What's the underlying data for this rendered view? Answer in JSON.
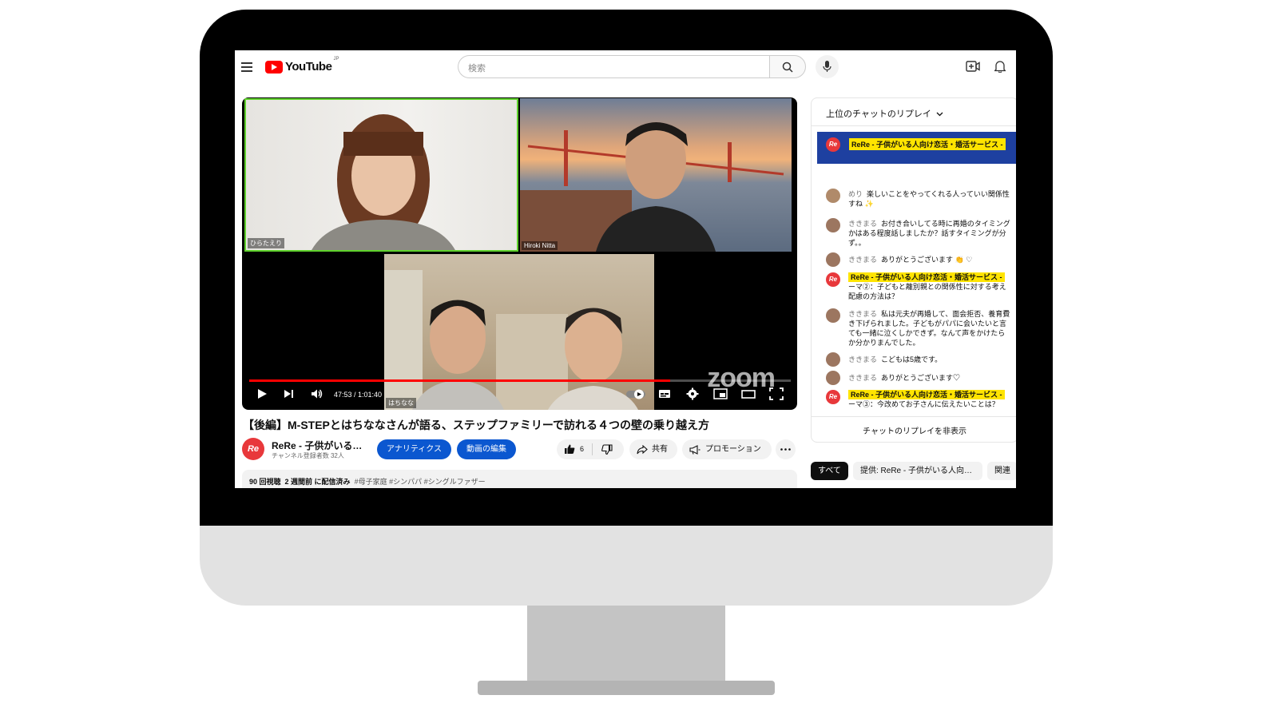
{
  "header": {
    "logo_text": "YouTube",
    "logo_region": "JP",
    "search_placeholder": "検索"
  },
  "player": {
    "participants": [
      "ひらたえり",
      "Hiroki Nitta",
      "はちなな"
    ],
    "watermark": "zoom",
    "time": "47:53 / 1:01:40",
    "progress": 0.777
  },
  "video": {
    "title": "【後編】M-STEPとはちななさんが語る、ステップファミリーで訪れる４つの壁の乗り越え方",
    "channel_name": "ReRe - 子供がいる…",
    "channel_subs": "チャンネル登録者数 32人",
    "avatar_text": "Re",
    "analytics_label": "アナリティクス",
    "edit_label": "動画の編集",
    "like_count": "6",
    "share_label": "共有",
    "promote_label": "プロモーション",
    "views": "90 回視聴",
    "date": "2 週間前 に配信済み",
    "tags": "#母子家庭 #シンパパ #シングルファザー"
  },
  "chat": {
    "header": "上位のチャットのリプレイ",
    "pinned_author": "ReRe - 子供がいる人向け恋活・婚活サービス -",
    "messages": [
      {
        "author": "めり",
        "lines": [
          "楽しいことをやってくれる人っていい関係性",
          "すね ✨"
        ]
      },
      {
        "author": "ききまる",
        "lines": [
          "お付き合いしてる時に再婚のタイミング",
          "かはある程度話しましたか？話すタイミングが分",
          "ず。。"
        ]
      },
      {
        "author": "ききまる",
        "lines": [
          "ありがとうございます 👏 ♡"
        ]
      },
      {
        "author": "ReRe - 子供がいる人向け恋活・婚活サービス -",
        "lines": [
          "ーマ②：子どもと離別親との関係性に対する考え",
          "配慮の方法は？"
        ]
      },
      {
        "author": "ききまる",
        "lines": [
          "私は元夫が再婚して、面会拒否、養育費",
          "き下げられました。子どもがパパに会いたいと言",
          "ても一緒に泣くしかできず。なんて声をかけたら",
          "か分かりまんでした。"
        ]
      },
      {
        "author": "ききまる",
        "lines": [
          "こどもは5歳です。"
        ]
      },
      {
        "author": "ききまる",
        "lines": [
          "ありがとうございます♡"
        ]
      },
      {
        "author": "ReRe - 子供がいる人向け恋活・婚活サービス -",
        "lines": [
          "ーマ③：今改めてお子さんに伝えたいことは？"
        ]
      }
    ],
    "hide_label": "チャットのリプレイを非表示"
  },
  "chips": [
    "すべて",
    "提供: ReRe - 子供がいる人向…",
    "関連"
  ],
  "colors": {
    "brand_red": "#ff0000",
    "accent_blue": "#0b57d0",
    "highlight_yellow": "#ffe400",
    "speaker_green": "#5fd22c"
  }
}
